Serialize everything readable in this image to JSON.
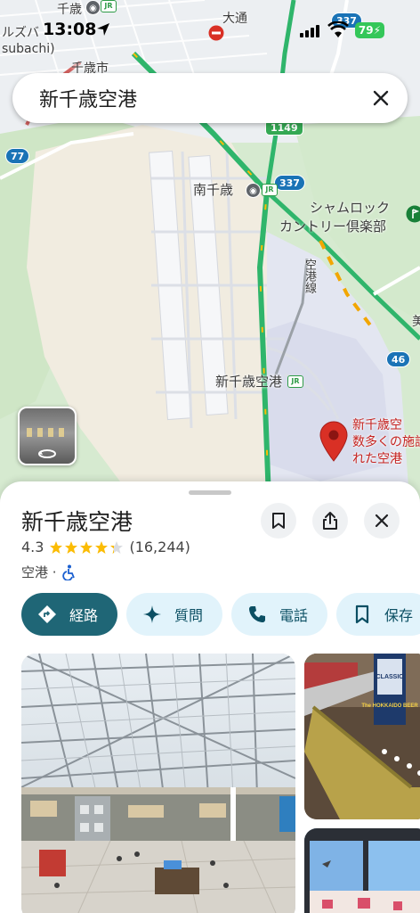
{
  "status_bar": {
    "time": "13:08",
    "battery": "79"
  },
  "search": {
    "query": "新千歳空港"
  },
  "map": {
    "labels": {
      "top_left_1": "ルズバ",
      "top_left_2": "subachi)",
      "chitose_city": "千歳市",
      "chitose_top": "千歳",
      "odori": "大通",
      "minami_chitose": "南千歳",
      "shamrock_1": "シャムロック",
      "shamrock_2": "カントリー倶楽部",
      "airport_line": "空港線",
      "airport_station": "新千歳空港",
      "pin_1": "新千歳空",
      "pin_2": "数多くの施設",
      "pin_3": "れた空港",
      "edge_char": "美"
    },
    "routes": {
      "r337_a": "337",
      "r337_b": "337",
      "r1149": "1149",
      "r77": "77",
      "r46": "46"
    },
    "jr": "JR"
  },
  "place": {
    "title": "新千歳空港",
    "rating": "4.3",
    "stars": 4.3,
    "review_count": "(16,244)",
    "category": "空港 ·"
  },
  "actions": {
    "directions": "経路",
    "ask": "質問",
    "call": "電話",
    "save": "保存"
  },
  "photos": {
    "beer_sign": "The HOKKAIDO BEER",
    "classic": "CLASSIC"
  },
  "colors": {
    "accent_teal": "#1f6676",
    "chip_bg": "#e1f3fb",
    "pin_red": "#d93025",
    "star_yellow": "#fbbc04",
    "road_green": "#2fb56b"
  }
}
